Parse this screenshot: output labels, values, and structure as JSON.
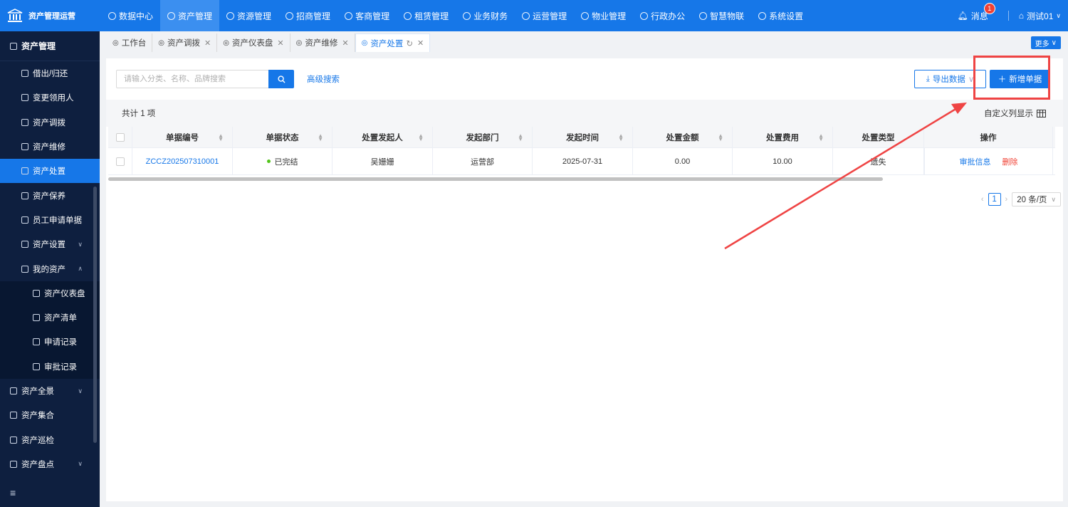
{
  "app": {
    "title": "资产管理运营"
  },
  "nav": [
    {
      "label": "数据中心",
      "icon": "clock-icon"
    },
    {
      "label": "资产管理",
      "icon": "cube-icon",
      "active": true
    },
    {
      "label": "资源管理",
      "icon": "building-icon"
    },
    {
      "label": "招商管理",
      "icon": "tag-icon"
    },
    {
      "label": "客商管理",
      "icon": "users-icon"
    },
    {
      "label": "租赁管理",
      "icon": "house-icon"
    },
    {
      "label": "业务财务",
      "icon": "coin-icon"
    },
    {
      "label": "运营管理",
      "icon": "chart-icon"
    },
    {
      "label": "物业管理",
      "icon": "home-icon"
    },
    {
      "label": "行政办公",
      "icon": "monitor-icon"
    },
    {
      "label": "智慧物联",
      "icon": "iot-icon"
    },
    {
      "label": "系统设置",
      "icon": "gear-icon"
    }
  ],
  "header": {
    "messages_label": "消息",
    "message_count": "1",
    "user_label": "测试01"
  },
  "sidebar": {
    "title": "资产管理",
    "items": [
      {
        "label": "借出/归还",
        "level": 1
      },
      {
        "label": "变更领用人",
        "level": 1
      },
      {
        "label": "资产调拨",
        "level": 1
      },
      {
        "label": "资产维修",
        "level": 1
      },
      {
        "label": "资产处置",
        "level": 1,
        "active": true
      },
      {
        "label": "资产保养",
        "level": 1
      },
      {
        "label": "员工申请单据",
        "level": 1
      },
      {
        "label": "资产设置",
        "level": 1,
        "chevron": "down"
      },
      {
        "label": "我的资产",
        "level": 1,
        "chevron": "up"
      },
      {
        "label": "资产仪表盘",
        "level": 2
      },
      {
        "label": "资产清单",
        "level": 2
      },
      {
        "label": "申请记录",
        "level": 2
      },
      {
        "label": "审批记录",
        "level": 2
      },
      {
        "label": "资产全景",
        "level": 0,
        "chevron": "down"
      },
      {
        "label": "资产集合",
        "level": 0
      },
      {
        "label": "资产巡检",
        "level": 0
      },
      {
        "label": "资产盘点",
        "level": 0,
        "chevron": "down"
      }
    ]
  },
  "tabs": [
    {
      "label": "工作台",
      "closable": false
    },
    {
      "label": "资产调拨",
      "closable": true
    },
    {
      "label": "资产仪表盘",
      "closable": true
    },
    {
      "label": "资产维修",
      "closable": true
    },
    {
      "label": "资产处置",
      "closable": true,
      "active": true
    }
  ],
  "more_label": "更多",
  "search": {
    "placeholder": "请输入分类、名称、品牌搜索",
    "advanced_label": "高级搜索"
  },
  "toolbar": {
    "export_label": "导出数据",
    "add_label": "新增单据"
  },
  "summary": {
    "count_text": "共计 1 项",
    "custom_columns_label": "自定义列显示"
  },
  "table": {
    "columns": [
      "单据编号",
      "单据状态",
      "处置发起人",
      "发起部门",
      "发起时间",
      "处置金额",
      "处置费用",
      "处置类型",
      "操作"
    ],
    "rows": [
      {
        "code": "ZCCZ202507310001",
        "status": "已完结",
        "initiator": "吴姗姗",
        "department": "运营部",
        "date": "2025-07-31",
        "amount": "0.00",
        "fee": "10.00",
        "type": "遗失",
        "actions": [
          "审批信息",
          "删除"
        ]
      }
    ]
  },
  "pagination": {
    "current": "1",
    "page_size_label": "20 条/页"
  },
  "colors": {
    "primary": "#1677e8",
    "sidebar": "#0e1f3f",
    "danger": "#f04134",
    "annotation": "#ef4444"
  }
}
